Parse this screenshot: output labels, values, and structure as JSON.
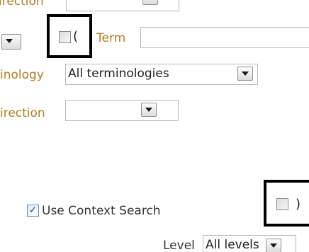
{
  "rows": {
    "direction_top": {
      "label": "irection"
    },
    "term": {
      "open_paren": "(",
      "label": "Term",
      "value": ""
    },
    "terminology": {
      "label": "inology",
      "selected": "All terminologies"
    },
    "direction": {
      "label": "irection",
      "selected": ""
    }
  },
  "context_search": {
    "label": "Use Context Search",
    "checked": true,
    "close_paren": ")"
  },
  "level": {
    "label": "Level",
    "selected": "All levels"
  },
  "colors": {
    "label_gold": "#b07e22",
    "highlight_border": "#000000",
    "checkmark": "#2a4c8c"
  }
}
